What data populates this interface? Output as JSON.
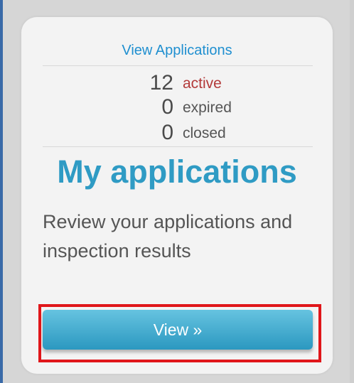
{
  "card": {
    "link_text": "View Applications",
    "stats": [
      {
        "count": "12",
        "label": "active"
      },
      {
        "count": "0",
        "label": "expired"
      },
      {
        "count": "0",
        "label": "closed"
      }
    ],
    "title": "My applications",
    "description": "Review your applications and inspection results",
    "button_label": "View »"
  },
  "colors": {
    "accent": "#2f9bc4",
    "link": "#1f8fd0",
    "active_label": "#b33a3a",
    "highlight_outline": "#e0161a"
  }
}
